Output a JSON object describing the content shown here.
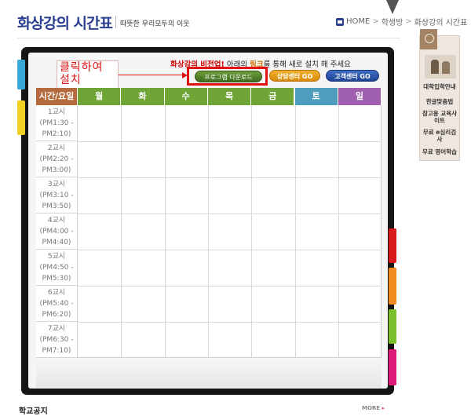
{
  "header": {
    "title": "화상강의 시간표",
    "subtitle": "따뜻한 우리모두의 이웃",
    "breadcrumb": [
      "HOME",
      "학생방",
      "화상강의 시간표"
    ]
  },
  "sidebar": {
    "items": [
      "대학입학안내",
      "한글맞춤법",
      "참고용 교육사이트",
      "무료 e심리검사",
      "무료 영어학습"
    ]
  },
  "notice": {
    "part1": "화상강의 비전업!",
    "part2": " 아래의 ",
    "part3": "링크",
    "part4": "를 통해 새로 설치 해 주세요"
  },
  "buttons": {
    "download": "프로그램 다운로드",
    "consult": "상담센터 GO",
    "customer": "고객센터 GO"
  },
  "callout": {
    "line1": "클릭하여",
    "line2": "설치"
  },
  "timetable": {
    "corner_label": "시간/요일",
    "days": [
      "월",
      "화",
      "수",
      "목",
      "금",
      "토",
      "일"
    ],
    "day_colors": [
      "#6ea536",
      "#6ea536",
      "#6ea536",
      "#6ea536",
      "#6ea536",
      "#4f9dbd",
      "#9f5fae"
    ],
    "periods": [
      {
        "name": "1교시",
        "start": "(PM1:30 -",
        "end": "PM2:10)"
      },
      {
        "name": "2교시",
        "start": "(PM2:20 -",
        "end": "PM3:00)"
      },
      {
        "name": "3교시",
        "start": "(PM3:10 -",
        "end": "PM3:50)"
      },
      {
        "name": "4교시",
        "start": "(PM4:00 -",
        "end": "PM4:40)"
      },
      {
        "name": "5교시",
        "start": "(PM4:50 -",
        "end": "PM5:30)"
      },
      {
        "name": "6교시",
        "start": "(PM5:40 -",
        "end": "PM6:20)"
      },
      {
        "name": "7교시",
        "start": "(PM6:30 -",
        "end": "PM7:10)"
      }
    ]
  },
  "footer": {
    "notice_title": "학교공지",
    "more_label": "MORE"
  },
  "colors": {
    "corner_header": "#b46a3c",
    "title_blue": "#2a3f8f",
    "highlight_red": "#e21111"
  }
}
